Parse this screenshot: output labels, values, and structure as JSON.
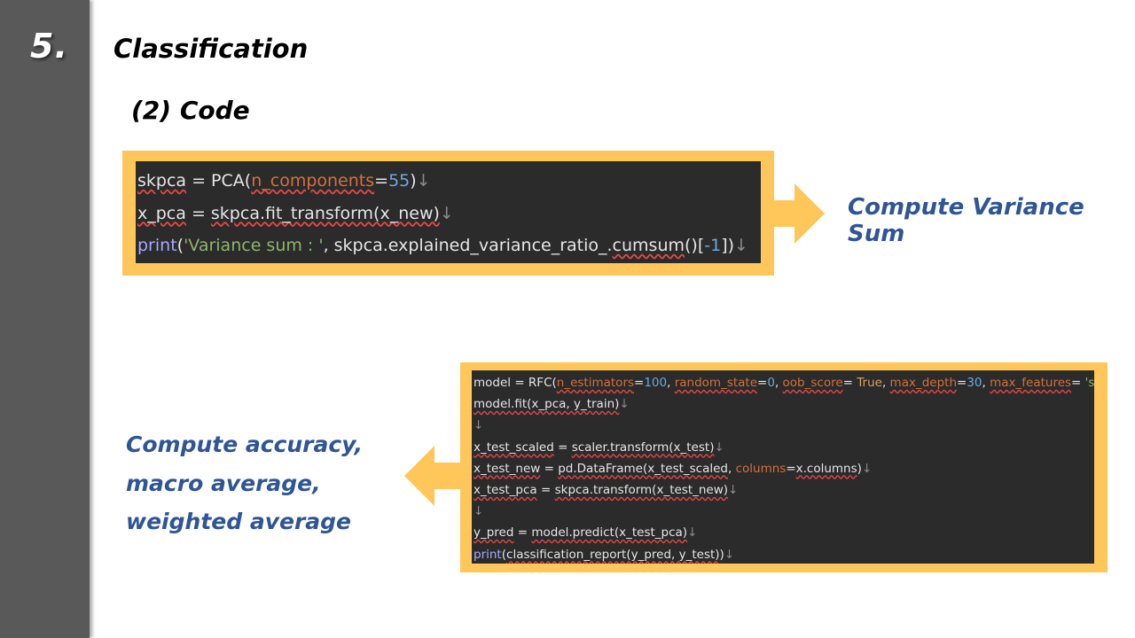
{
  "slide": {
    "section_number": "5.",
    "title": "Classification",
    "subtitle": "(2) Code"
  },
  "code_block_1": {
    "lines": [
      [
        {
          "t": "skpca",
          "c": "wv"
        },
        {
          "t": " = PCA(",
          "c": "w"
        },
        {
          "t": "n_components",
          "c": "pw"
        },
        {
          "t": "=",
          "c": "w"
        },
        {
          "t": "55",
          "c": "n"
        },
        {
          "t": ")",
          "c": "w"
        },
        {
          "t": "↓",
          "c": "ret"
        }
      ],
      [
        {
          "t": "x_pca",
          "c": "wv"
        },
        {
          "t": " = ",
          "c": "w"
        },
        {
          "t": "skpca.fit_transform(x_new)",
          "c": "wv"
        },
        {
          "t": "↓",
          "c": "ret"
        }
      ],
      [
        {
          "t": "print",
          "c": "b"
        },
        {
          "t": "(",
          "c": "w"
        },
        {
          "t": "'Variance sum : '",
          "c": "s"
        },
        {
          "t": ", skpca.explained_variance_ratio_.",
          "c": "w"
        },
        {
          "t": "cumsum",
          "c": "wv"
        },
        {
          "t": "()[",
          "c": "w"
        },
        {
          "t": "-1",
          "c": "n"
        },
        {
          "t": "])",
          "c": "w"
        },
        {
          "t": "↓",
          "c": "ret"
        }
      ]
    ]
  },
  "code_block_2": {
    "lines": [
      [
        {
          "t": "model = RFC(",
          "c": "w"
        },
        {
          "t": "n_estimators",
          "c": "pw"
        },
        {
          "t": "=",
          "c": "w"
        },
        {
          "t": "100",
          "c": "n"
        },
        {
          "t": ", ",
          "c": "w"
        },
        {
          "t": "random_state",
          "c": "pw"
        },
        {
          "t": "=",
          "c": "w"
        },
        {
          "t": "0",
          "c": "n"
        },
        {
          "t": ", ",
          "c": "w"
        },
        {
          "t": "oob_score",
          "c": "pw"
        },
        {
          "t": "= ",
          "c": "w"
        },
        {
          "t": "True",
          "c": "k"
        },
        {
          "t": ", ",
          "c": "w"
        },
        {
          "t": "max_depth",
          "c": "pw"
        },
        {
          "t": "=",
          "c": "w"
        },
        {
          "t": "30",
          "c": "n"
        },
        {
          "t": ", ",
          "c": "w"
        },
        {
          "t": "max_features",
          "c": "pw"
        },
        {
          "t": "= ",
          "c": "w"
        },
        {
          "t": "'sqrt'",
          "c": "s"
        },
        {
          "t": ")",
          "c": "w"
        },
        {
          "t": "↓",
          "c": "ret"
        }
      ],
      [
        {
          "t": "model.fit(x_pca, y_train)",
          "c": "wv"
        },
        {
          "t": "↓",
          "c": "ret"
        }
      ],
      [
        {
          "t": "↓",
          "c": "ret"
        }
      ],
      [
        {
          "t": "x_test_scaled",
          "c": "wv"
        },
        {
          "t": " = ",
          "c": "w"
        },
        {
          "t": "scaler.transform(x_test)",
          "c": "wv"
        },
        {
          "t": "↓",
          "c": "ret"
        }
      ],
      [
        {
          "t": "x_test_new",
          "c": "wv"
        },
        {
          "t": " = ",
          "c": "w"
        },
        {
          "t": "pd.DataFrame(x_test_scaled",
          "c": "wv"
        },
        {
          "t": ", ",
          "c": "w"
        },
        {
          "t": "columns",
          "c": "p"
        },
        {
          "t": "=",
          "c": "w"
        },
        {
          "t": "x.columns",
          "c": "wv"
        },
        {
          "t": ")",
          "c": "w"
        },
        {
          "t": "↓",
          "c": "ret"
        }
      ],
      [
        {
          "t": "x_test_pca",
          "c": "wv"
        },
        {
          "t": " = ",
          "c": "w"
        },
        {
          "t": "skpca.transform(x_test_new)",
          "c": "wv"
        },
        {
          "t": "↓",
          "c": "ret"
        }
      ],
      [
        {
          "t": "↓",
          "c": "ret"
        }
      ],
      [
        {
          "t": "y_pred",
          "c": "wv"
        },
        {
          "t": " = ",
          "c": "w"
        },
        {
          "t": "model.predict(x_test_pca)",
          "c": "wv"
        },
        {
          "t": "↓",
          "c": "ret"
        }
      ],
      [
        {
          "t": "print",
          "c": "b"
        },
        {
          "t": "(",
          "c": "w"
        },
        {
          "t": "classification_report(y_pred, y_test)",
          "c": "wv"
        },
        {
          "t": ")",
          "c": "w"
        },
        {
          "t": "↓",
          "c": "ret"
        }
      ]
    ]
  },
  "annotations": {
    "right_label": "Compute Variance Sum",
    "left_label_lines": [
      "Compute accuracy,",
      "macro average,",
      "weighted average"
    ]
  },
  "colors": {
    "sidebar": "#595959",
    "frame": "#ffc759",
    "code_background": "#2b2b2b",
    "label_blue": "#2f5597"
  },
  "icons": {
    "right_arrow": "arrow-right-icon",
    "left_arrow": "arrow-left-icon"
  }
}
